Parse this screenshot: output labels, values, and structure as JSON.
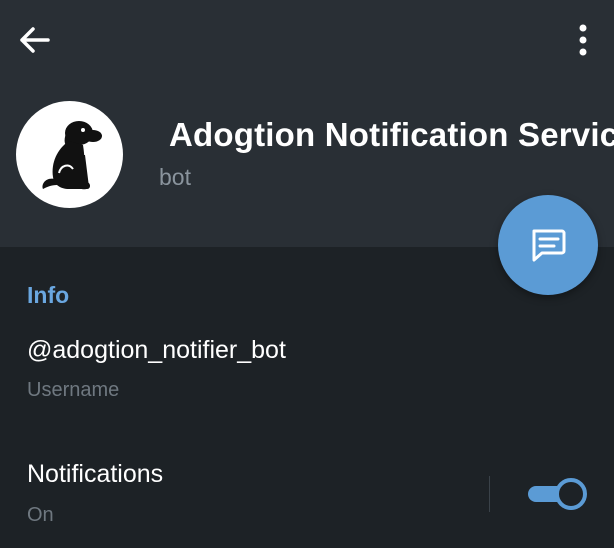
{
  "header": {
    "title": "Adogtion Notification Service",
    "subtitle": "bot",
    "back_icon": "arrow-left-icon",
    "menu_icon": "more-vertical-icon",
    "avatar_icon": "dog-silhouette-icon"
  },
  "fab": {
    "icon": "message-icon"
  },
  "info": {
    "section_title": "Info",
    "username": "@adogtion_notifier_bot",
    "username_label": "Username"
  },
  "notifications": {
    "title": "Notifications",
    "status": "On",
    "enabled": true
  },
  "colors": {
    "background": "#1d2226",
    "header": "#292f35",
    "accent": "#5b9bd5",
    "section_title": "#6aa7e0",
    "muted_text": "#6f7880"
  }
}
